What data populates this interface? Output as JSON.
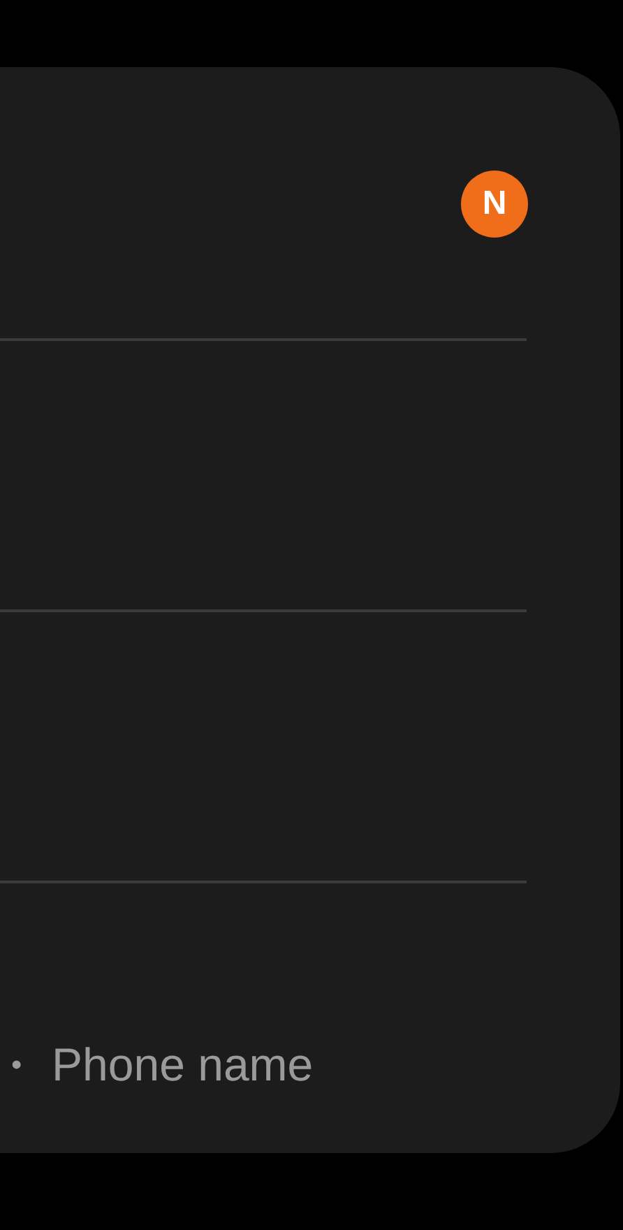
{
  "badge": {
    "text": "N",
    "color": "#f06d1a"
  },
  "footer": {
    "bullet": "•",
    "text": "Phone name"
  }
}
